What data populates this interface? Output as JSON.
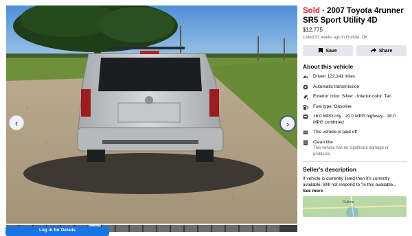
{
  "listing": {
    "sold_label": "Sold",
    "separator": " · ",
    "title": "2007 Toyota 4runner SR5 Sport Utility 4D",
    "price": "$12,775",
    "listed_info": "Listed 31 weeks ago in Guthrie, OK"
  },
  "actions": {
    "save_label": "Save",
    "share_label": "Share"
  },
  "about": {
    "heading": "About this vehicle",
    "specs": [
      {
        "icon": "odometer-icon",
        "text": "Driven 122,141 miles"
      },
      {
        "icon": "transmission-icon",
        "text": "Automatic transmission"
      },
      {
        "icon": "paint-icon",
        "text": "Exterior color: Silver · Interior color: Tan"
      },
      {
        "icon": "fuel-icon",
        "text": "Fuel type: Gasoline"
      },
      {
        "icon": "mpg-icon",
        "text": "16.0 MPG city · 20.0 MPG highway · 18.0 MPG combined"
      },
      {
        "icon": "paid-icon",
        "text": "This vehicle is paid off"
      },
      {
        "icon": "clean-title-icon",
        "text": "Clean title",
        "subtext": "This vehicle has no significant damage or problems."
      }
    ]
  },
  "seller": {
    "heading": "Seller's description",
    "description": "If vehicle is currently listed then it's currently available. Will not respond to \"is this available...",
    "see_more": "See more",
    "map_label": "Guthrie"
  },
  "login_label": "Log in for Details",
  "colors": {
    "sold": "#e41e3f",
    "primary": "#1b74e4",
    "button_bg": "#e4e6eb"
  }
}
